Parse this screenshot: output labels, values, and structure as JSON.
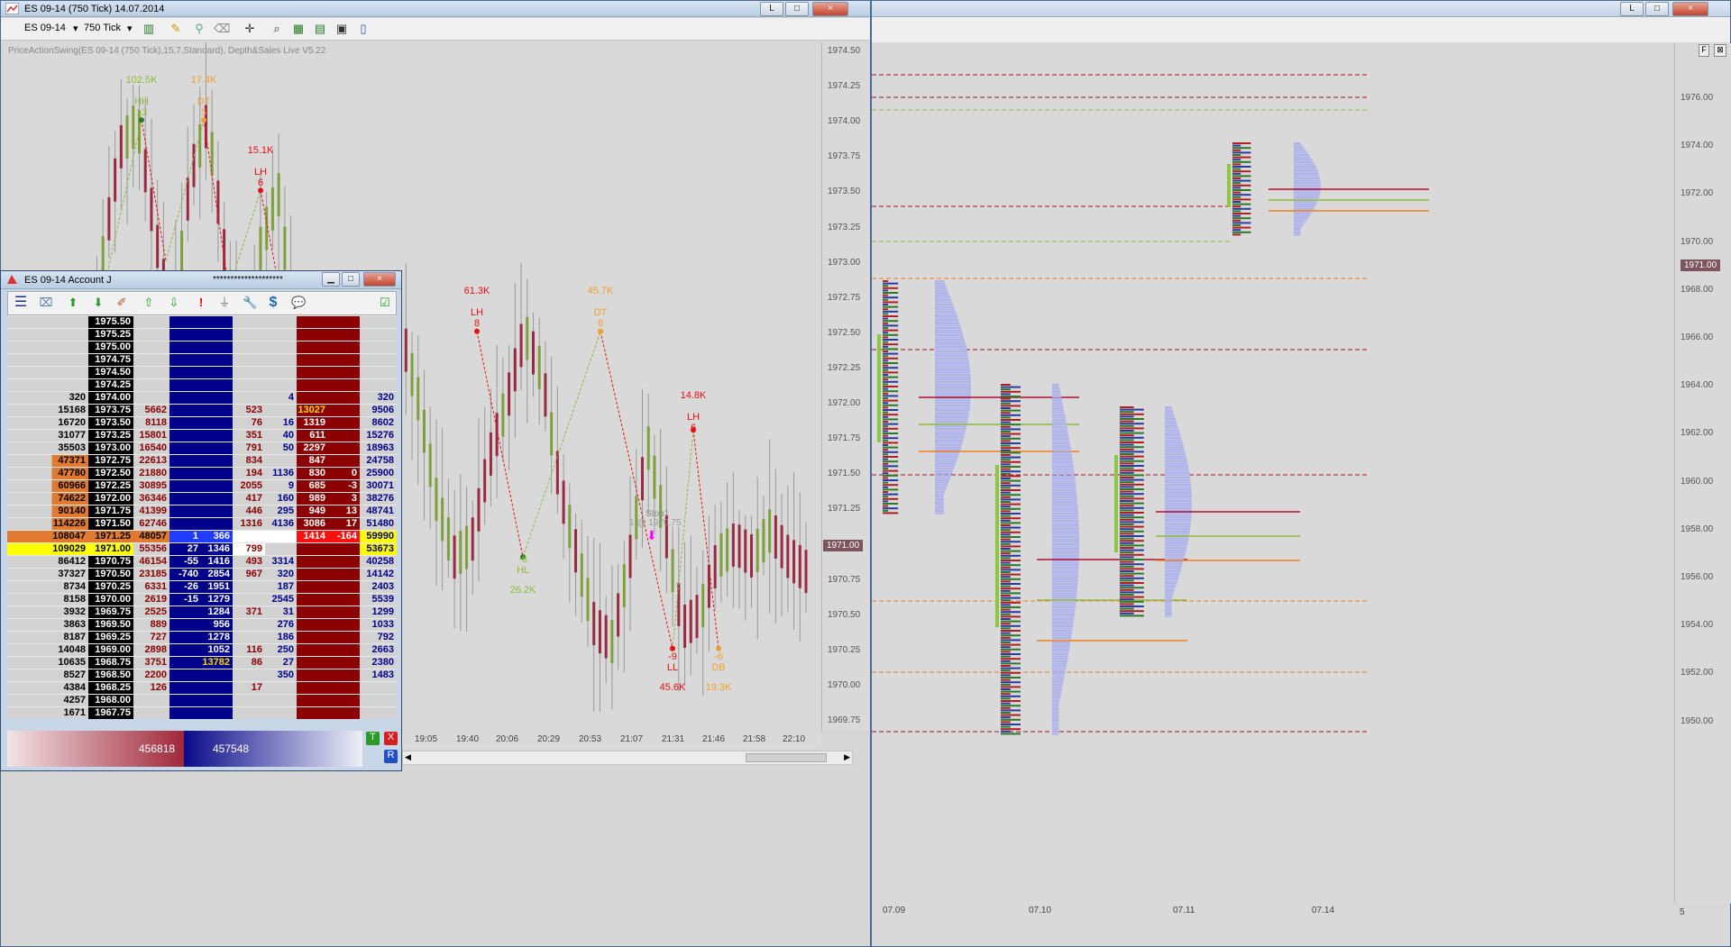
{
  "left_window": {
    "title": "ES 09-14 (750 Tick)  14.07.2014",
    "toolbar": {
      "instrument": "ES 09-14",
      "interval": "750 Tick"
    },
    "indicator_label": "PriceActionSwing(ES 09-14 (750 Tick),15,7,Standard), Depth&Sales Live V5.22",
    "price_axis": [
      "1974.50",
      "1974.25",
      "1974.00",
      "1973.75",
      "1973.50",
      "1973.25",
      "1973.00",
      "1972.75",
      "1972.50",
      "1972.25",
      "1972.00",
      "1971.75",
      "1971.50",
      "1971.25",
      "1971.00",
      "1970.75",
      "1970.50",
      "1970.25",
      "1970.00",
      "1969.75"
    ],
    "last_price": "1971.00",
    "time_axis": [
      "19:05",
      "19:40",
      "20:06",
      "20:29",
      "20:53",
      "21:07",
      "21:31",
      "21:46",
      "21:58",
      "22:10"
    ],
    "swing_labels": [
      {
        "vol": "102.5K",
        "type": "HH",
        "bars": "13",
        "color": "#8db93a"
      },
      {
        "vol": "17.4K",
        "type": "DT",
        "bars": "5",
        "color": "#f0a030"
      },
      {
        "vol": "15.1K",
        "type": "LH",
        "bars": "6",
        "color": "#e81010"
      },
      {
        "vol": "61.3K",
        "type": "LH",
        "bars": "8",
        "color": "#e81010"
      },
      {
        "vol": "45.7K",
        "type": "DT",
        "bars": "6",
        "color": "#f0a030"
      },
      {
        "vol": "14.8K",
        "type": "LH",
        "bars": "6",
        "color": "#e81010"
      },
      {
        "vol": "26.2K",
        "type": "HL",
        "bars": "-6",
        "color": "#8db93a"
      },
      {
        "vol": "45.6K",
        "type": "LL",
        "bars": "-9",
        "color": "#e81010"
      },
      {
        "vol": "19.3K",
        "type": "DB",
        "bars": "-6",
        "color": "#f0a030"
      }
    ],
    "stop_label": "Stop1",
    "stop_sub": "1 @ 1970.75",
    "buttons": {
      "min": "L",
      "restore": "□",
      "close": "×"
    }
  },
  "right_window": {
    "price_axis": [
      "1976.00",
      "1974.00",
      "1972.00",
      "1970.00",
      "1968.00",
      "1966.00",
      "1964.00",
      "1962.00",
      "1960.00",
      "1958.00",
      "1956.00",
      "1954.00",
      "1952.00",
      "1950.00"
    ],
    "last_price": "1971.00",
    "date_axis": [
      "07.09",
      "07.10",
      "07.11",
      "07.14"
    ],
    "corner_value": "5",
    "corner_f": "F",
    "buttons": {
      "min": "L",
      "restore": "□",
      "close": "×"
    }
  },
  "dom_window": {
    "title": "ES 09-14  Account J",
    "masked_account": "********************",
    "rows": [
      {
        "c1": "",
        "price": "1975.50",
        "ask": "",
        "c5": "",
        "c6": "",
        "bid": "",
        "c8": "",
        "c9": "",
        "c10": ""
      },
      {
        "c1": "",
        "price": "1975.25",
        "ask": "",
        "c5": "",
        "c6": "",
        "bid": "",
        "c8": "",
        "c9": "",
        "c10": ""
      },
      {
        "c1": "",
        "price": "1975.00",
        "ask": "",
        "c5": "",
        "c6": "",
        "bid": "",
        "c8": "",
        "c9": "",
        "c10": ""
      },
      {
        "c1": "",
        "price": "1974.75",
        "ask": "",
        "c5": "",
        "c6": "",
        "bid": "",
        "c8": "",
        "c9": "",
        "c10": ""
      },
      {
        "c1": "",
        "price": "1974.50",
        "ask": "",
        "c5": "",
        "c6": "",
        "bid": "",
        "c8": "",
        "c9": "",
        "c10": ""
      },
      {
        "c1": "",
        "price": "1974.25",
        "ask": "",
        "c5": "",
        "c6": "",
        "bid": "",
        "c8": "",
        "c9": "",
        "c10": ""
      },
      {
        "c1": "320",
        "price": "1974.00",
        "ask": "",
        "c5": "",
        "c6": "",
        "c7": "",
        "c8": "4",
        "c9": "",
        "c10": "",
        "c11": "320"
      },
      {
        "c1": "15168",
        "price": "1973.75",
        "ask": "5662",
        "c5": "",
        "c6": "",
        "c7": "523",
        "c8": "",
        "c9": "13027",
        "c10": "",
        "c11": "9506"
      },
      {
        "c1": "16720",
        "price": "1973.50",
        "ask": "8118",
        "c5": "",
        "c6": "",
        "c7": "76",
        "c8": "16",
        "c9": "1319",
        "c10": "",
        "c11": "8602"
      },
      {
        "c1": "31077",
        "price": "1973.25",
        "ask": "15801",
        "c5": "",
        "c6": "",
        "c7": "351",
        "c8": "40",
        "c9": "611",
        "c10": "",
        "c11": "15276"
      },
      {
        "c1": "35503",
        "price": "1973.00",
        "ask": "16540",
        "c5": "",
        "c6": "",
        "c7": "791",
        "c8": "50",
        "c9": "2297",
        "c10": "",
        "c11": "18963"
      },
      {
        "c1": "47371",
        "price": "1972.75",
        "ask": "22613",
        "c5": "",
        "c6": "",
        "c7": "834",
        "c8": "",
        "c9": "847",
        "c10": "",
        "c11": "24758"
      },
      {
        "c1": "47780",
        "price": "1972.50",
        "ask": "21880",
        "c5": "",
        "c6": "",
        "c7": "194",
        "c8": "1136",
        "c9": "830",
        "c10": "0",
        "c11": "25900"
      },
      {
        "c1": "60966",
        "price": "1972.25",
        "ask": "30895",
        "c5": "",
        "c6": "",
        "c7": "2055",
        "c8": "9",
        "c9": "685",
        "c10": "-3",
        "c11": "30071"
      },
      {
        "c1": "74622",
        "price": "1972.00",
        "ask": "36346",
        "c5": "",
        "c6": "",
        "c7": "417",
        "c8": "160",
        "c9": "989",
        "c10": "3",
        "c11": "38276"
      },
      {
        "c1": "90140",
        "price": "1971.75",
        "ask": "41399",
        "c5": "",
        "c6": "",
        "c7": "446",
        "c8": "295",
        "c9": "949",
        "c10": "13",
        "c11": "48741"
      },
      {
        "c1": "114226",
        "price": "1971.50",
        "ask": "62746",
        "c5": "",
        "c6": "",
        "c7": "1316",
        "c8": "4136",
        "c9": "3086",
        "c10": "17",
        "c11": "51480"
      },
      {
        "c1": "108047",
        "price": "1971.25",
        "ask": "48057",
        "c5": "1",
        "c6": "366",
        "c7": "",
        "c8": "",
        "c9": "1414",
        "c10": "-164",
        "c11": "59990"
      },
      {
        "c1": "109029",
        "price": "1971.00",
        "ask": "55356",
        "c5": "27",
        "c6": "1346",
        "c7": "799",
        "c8": "",
        "c9": "",
        "c10": "",
        "c11": "53673"
      },
      {
        "c1": "86412",
        "price": "1970.75",
        "ask": "46154",
        "c5": "-55",
        "c6": "1416",
        "c7": "493",
        "c8": "3314",
        "c9": "",
        "c10": "",
        "c11": "40258"
      },
      {
        "c1": "37327",
        "price": "1970.50",
        "ask": "23185",
        "c5": "-740",
        "c6": "2854",
        "c7": "967",
        "c8": "320",
        "c9": "",
        "c10": "",
        "c11": "14142"
      },
      {
        "c1": "8734",
        "price": "1970.25",
        "ask": "6331",
        "c5": "-26",
        "c6": "1951",
        "c7": "",
        "c8": "187",
        "c9": "",
        "c10": "",
        "c11": "2403"
      },
      {
        "c1": "8158",
        "price": "1970.00",
        "ask": "2619",
        "c5": "-15",
        "c6": "1279",
        "c7": "",
        "c8": "2545",
        "c9": "",
        "c10": "",
        "c11": "5539"
      },
      {
        "c1": "3932",
        "price": "1969.75",
        "ask": "2525",
        "c5": "",
        "c6": "1284",
        "c7": "371",
        "c8": "31",
        "c9": "",
        "c10": "",
        "c11": "1299"
      },
      {
        "c1": "3863",
        "price": "1969.50",
        "ask": "889",
        "c5": "",
        "c6": "956",
        "c7": "",
        "c8": "276",
        "c9": "",
        "c10": "",
        "c11": "1033"
      },
      {
        "c1": "8187",
        "price": "1969.25",
        "ask": "727",
        "c5": "",
        "c6": "1278",
        "c7": "",
        "c8": "186",
        "c9": "",
        "c10": "",
        "c11": "792"
      },
      {
        "c1": "14048",
        "price": "1969.00",
        "ask": "2898",
        "c5": "",
        "c6": "1052",
        "c7": "116",
        "c8": "250",
        "c9": "",
        "c10": "",
        "c11": "2663"
      },
      {
        "c1": "10635",
        "price": "1968.75",
        "ask": "3751",
        "c5": "",
        "c6": "13782",
        "c7": "86",
        "c8": "27",
        "c9": "",
        "c10": "",
        "c11": "2380"
      },
      {
        "c1": "8527",
        "price": "1968.50",
        "ask": "2200",
        "c5": "",
        "c6": "",
        "c7": "",
        "c8": "350",
        "c9": "",
        "c10": "",
        "c11": "1483"
      },
      {
        "c1": "4384",
        "price": "1968.25",
        "ask": "126",
        "c5": "",
        "c6": "",
        "c7": "17",
        "c8": "",
        "c9": "",
        "c10": "",
        "c11": ""
      },
      {
        "c1": "4257",
        "price": "1968.00",
        "ask": "",
        "c5": "",
        "c6": "",
        "c7": "",
        "c8": "",
        "c9": "",
        "c10": "",
        "c11": ""
      },
      {
        "c1": "1671",
        "price": "1967.75",
        "ask": "",
        "c5": "",
        "c6": "",
        "c7": "",
        "c8": "",
        "c9": "",
        "c10": "",
        "c11": ""
      }
    ],
    "sell_total": "456818",
    "buy_total": "457548",
    "btn_t": "T",
    "btn_x": "X",
    "btn_r": "R",
    "buttons": {
      "min": "▁",
      "restore": "□",
      "close": "×"
    }
  },
  "colors": {
    "up_bar": "#7e9f3b",
    "down_bar": "#9a2a42",
    "ask_col": "#00008b",
    "bid_col": "#8b0000",
    "accent": "#ffff00"
  }
}
